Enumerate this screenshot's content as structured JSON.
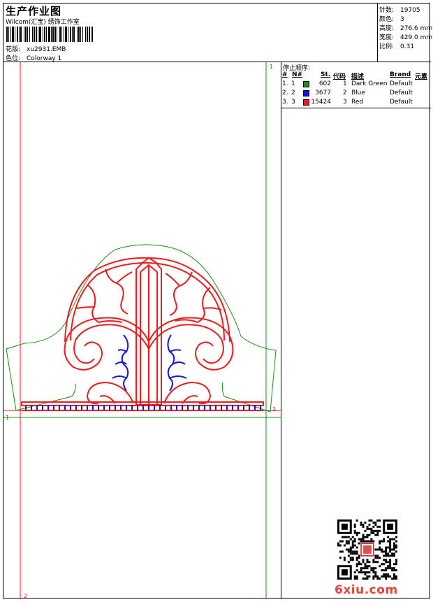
{
  "header": {
    "title": "生产作业图",
    "subtitle": "Wilcom(汇宝) 绣饰工作室",
    "design_label": "花版:",
    "design_value": "xu2931.EMB",
    "colorway_label": "色位:",
    "colorway_value": "Colorway 1"
  },
  "stats": [
    {
      "label": "针数:",
      "value": "19705"
    },
    {
      "label": "颜色:",
      "value": "3"
    },
    {
      "label": "高度:",
      "value": "276.6 mm"
    },
    {
      "label": "宽度:",
      "value": "429.0 mm"
    },
    {
      "label": "比例:",
      "value": "0.31"
    }
  ],
  "stop_sequence": {
    "title": "停止顺序:",
    "columns": [
      "#",
      "N#",
      "St.",
      "代码",
      "描述",
      "Brand",
      "元素"
    ],
    "rows": [
      {
        "num": "1.",
        "n": "1",
        "color": "#1a8c1a",
        "stitches": "602",
        "code": "1",
        "desc": "Dark Green",
        "brand": "Default"
      },
      {
        "num": "2.",
        "n": "2",
        "color": "#1515e0",
        "stitches": "3677",
        "code": "2",
        "desc": "Blue",
        "brand": "Default"
      },
      {
        "num": "3.",
        "n": "3",
        "color": "#ee1c1c",
        "stitches": "15424",
        "code": "3",
        "desc": "Red",
        "brand": "Default"
      }
    ]
  },
  "guides": {
    "marker_1": "1",
    "marker_2": "2"
  },
  "footer": {
    "brand": "6xiu.com"
  },
  "colors": {
    "green": "#1a8c1a",
    "blue": "#1515e0",
    "red": "#ee1c1c"
  }
}
